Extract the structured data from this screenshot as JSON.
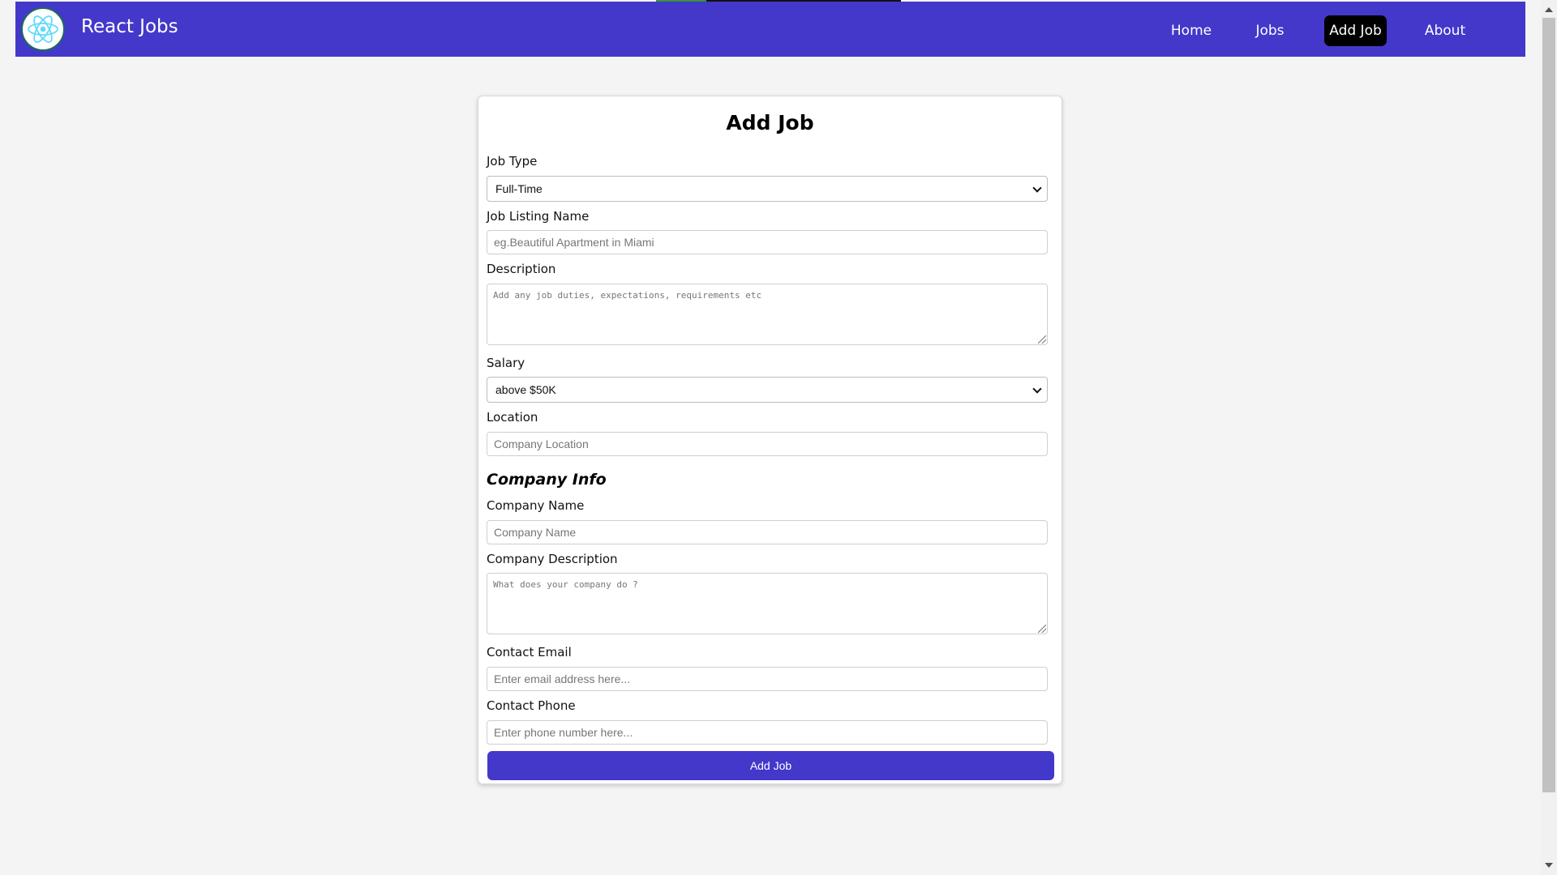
{
  "navbar": {
    "brand": "React Jobs",
    "links": [
      {
        "label": "Home",
        "active": false
      },
      {
        "label": "Jobs",
        "active": false
      },
      {
        "label": "Add Job",
        "active": true
      },
      {
        "label": "About",
        "active": false
      }
    ],
    "bg_color": "#4338ca",
    "active_bg_color": "#000000"
  },
  "form": {
    "title": "Add Job",
    "job_type": {
      "label": "Job Type",
      "value": "Full-Time"
    },
    "job_listing_name": {
      "label": "Job Listing Name",
      "placeholder": "eg.Beautiful Apartment in Miami"
    },
    "description": {
      "label": "Description",
      "placeholder": "Add any job duties, expectations, requirements etc"
    },
    "salary": {
      "label": "Salary",
      "value": "above $50K"
    },
    "location": {
      "label": "Location",
      "placeholder": "Company Location"
    },
    "company_info": {
      "title": "Company Info"
    },
    "company_name": {
      "label": "Company Name",
      "placeholder": "Company Name"
    },
    "company_description": {
      "label": "Company Description",
      "placeholder": "What does your company do ?"
    },
    "contact_email": {
      "label": "Contact Email",
      "placeholder": "Enter email address here..."
    },
    "contact_phone": {
      "label": "Contact Phone",
      "placeholder": "Enter phone number here..."
    },
    "submit_label": "Add Job",
    "button_color": "#4338ca"
  },
  "icons": {
    "logo": "react-atom-icon",
    "select_arrow": "chevron-down-icon"
  }
}
